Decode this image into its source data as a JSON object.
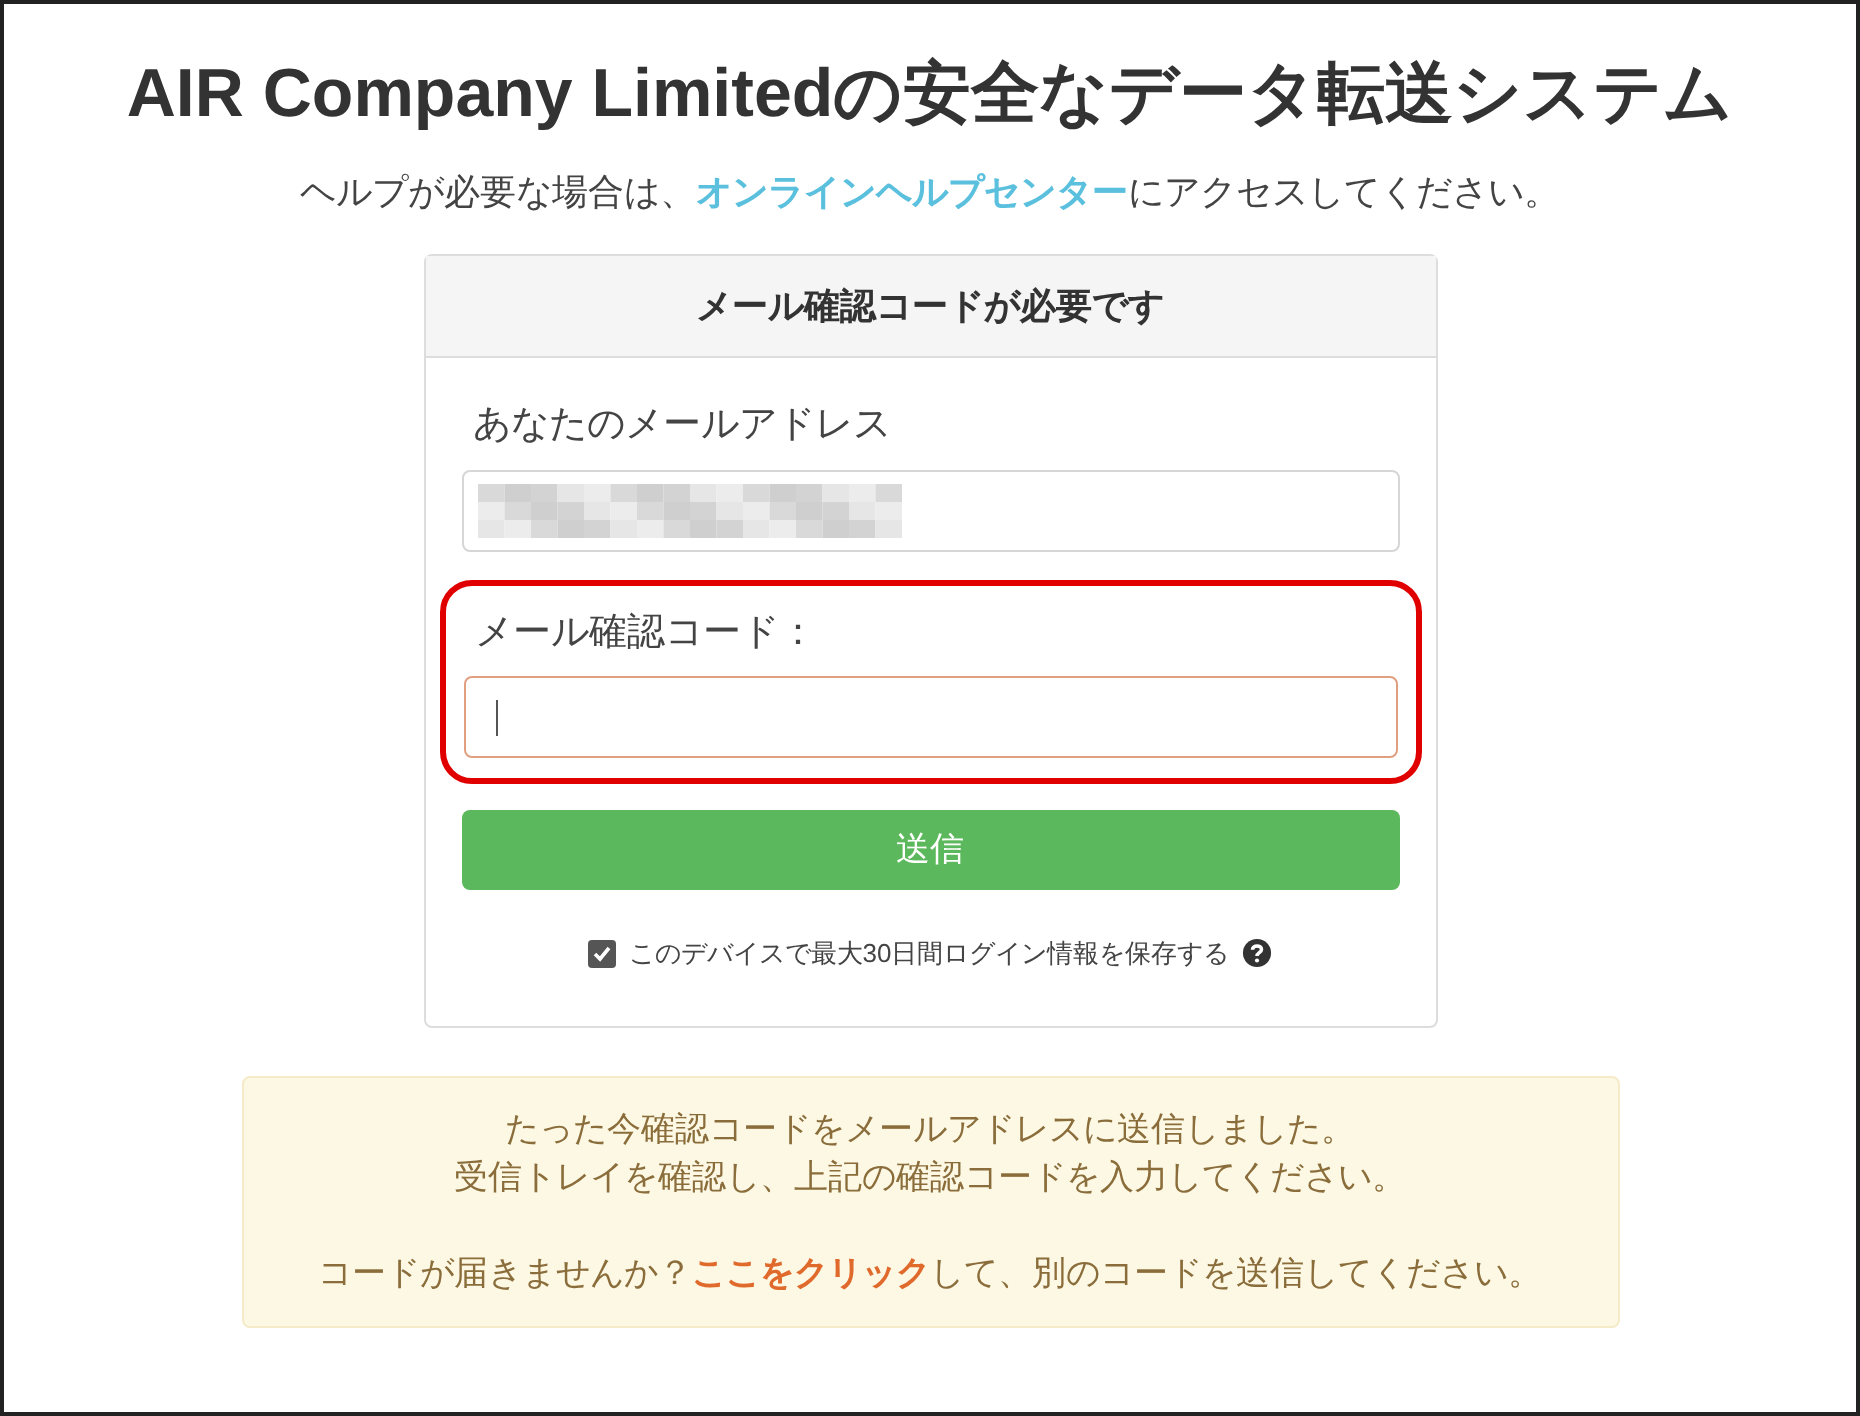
{
  "title": "AIR Company Limitedの安全なデータ転送システム",
  "help": {
    "before": "ヘルプが必要な場合は、",
    "link": "オンラインヘルプセンター",
    "after": "にアクセスしてください。"
  },
  "card": {
    "header": "メール確認コードが必要です",
    "fields": [
      {
        "label": "あなたのメールアドレス",
        "kind": "redacted",
        "highlighted": false,
        "focused": false
      },
      {
        "label": "メール確認コード：",
        "kind": "code",
        "highlighted": true,
        "focused": true
      }
    ],
    "submit": "送信",
    "remember": {
      "label": "このデバイスで最大30日間ログイン情報を保存する",
      "checked": true
    }
  },
  "notice": {
    "lines": [
      "たった今確認コードをメールアドレスに送信しました。",
      "受信トレイを確認し、上記の確認コードを入力してください。"
    ],
    "resend": {
      "before": "コードが届きませんか？",
      "link": "ここをクリック",
      "after": "して、別のコードを送信してください。"
    }
  }
}
